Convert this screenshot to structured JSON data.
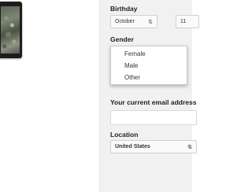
{
  "birthday": {
    "label": "Birthday",
    "month": "October",
    "day": "11",
    "arrow": "⇅"
  },
  "gender": {
    "label": "Gender",
    "options": [
      "Female",
      "Male",
      "Other"
    ]
  },
  "email": {
    "label": "Your current email address",
    "value": ""
  },
  "location": {
    "label": "Location",
    "value": "United States",
    "arrow": "⇅"
  },
  "colors": {
    "panel_bg": "#f1f1f1",
    "accent_red": "#d23f31"
  }
}
